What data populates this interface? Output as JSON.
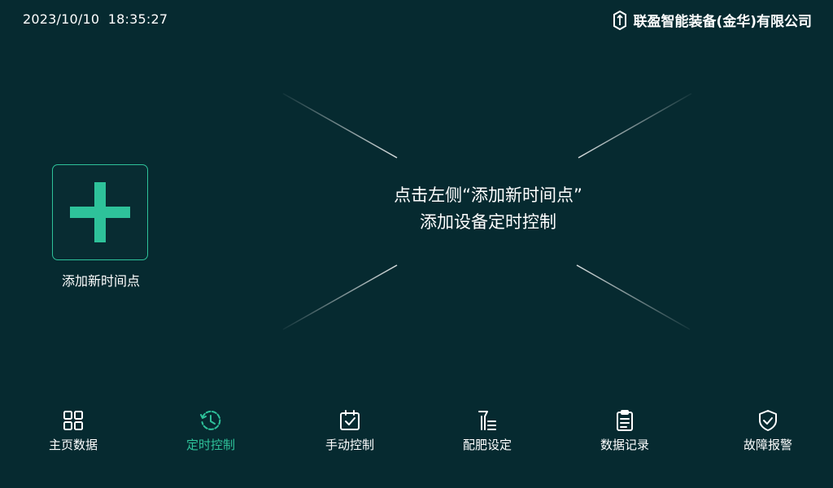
{
  "status_bar": {
    "datetime": "2023/10/10  18:35:27",
    "company": "联盈智能装备(金华)有限公司"
  },
  "add_timepoint": {
    "label": "添加新时间点",
    "icon": "plus-icon"
  },
  "hint": {
    "line1": "点击左侧“添加新时间点”",
    "line2": "添加设备定时控制"
  },
  "nav": {
    "active": "定时控制",
    "items": [
      {
        "label": "主页数据",
        "icon": "grid-icon"
      },
      {
        "label": "定时控制",
        "icon": "clock-icon"
      },
      {
        "label": "手动控制",
        "icon": "calendar-check-icon"
      },
      {
        "label": "配肥设定",
        "icon": "fertilizer-icon"
      },
      {
        "label": "数据记录",
        "icon": "clipboard-icon"
      },
      {
        "label": "故障报警",
        "icon": "shield-check-icon"
      }
    ]
  },
  "colors": {
    "background": "#062a30",
    "accent": "#2ec29a",
    "text": "#ffffff"
  }
}
